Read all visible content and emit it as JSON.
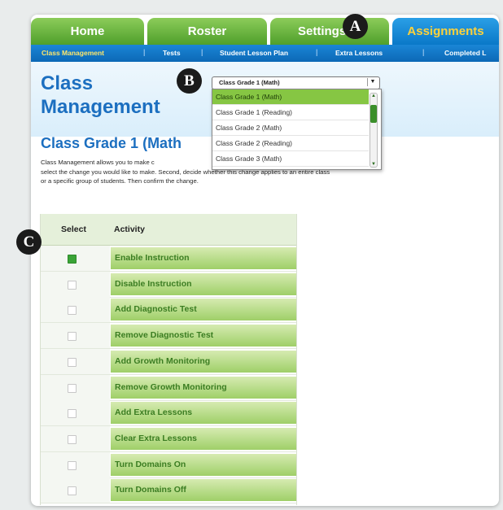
{
  "tabs": [
    {
      "label": "Home"
    },
    {
      "label": "Roster"
    },
    {
      "label": "Settings"
    },
    {
      "label": "Assignments"
    }
  ],
  "subnav": [
    {
      "label": "Class Management"
    },
    {
      "label": "Tests"
    },
    {
      "label": "Student Lesson Plan"
    },
    {
      "label": "Extra Lessons"
    },
    {
      "label": "Completed L"
    }
  ],
  "page_title_line1": "Class",
  "page_title_line2": "Management",
  "class_select": {
    "value": "Class Grade 1 (Math)",
    "arrow": "▼",
    "options": [
      "Class Grade 1 (Math)",
      "Class Grade 1 (Reading)",
      "Class Grade 2 (Math)",
      "Class Grade 2 (Reading)",
      "Class Grade 3 (Math)"
    ]
  },
  "content_title": "Class Grade 1 (Math",
  "description_lines": [
    "Class Management allows you to make c                                                  oup of students. First,",
    "select the change you would like to make. Second, decide whether this change applies to an entire class",
    "or a specific group of students. Then confirm the change."
  ],
  "table": {
    "headers": {
      "select": "Select",
      "activity": "Activity"
    },
    "rows": [
      {
        "activity": "Enable Instruction",
        "checked": true
      },
      {
        "activity": "Disable Instruction",
        "checked": false
      },
      {
        "activity": "Add Diagnostic Test",
        "checked": false
      },
      {
        "activity": "Remove Diagnostic Test",
        "checked": false
      },
      {
        "activity": "Add Growth Monitoring",
        "checked": false
      },
      {
        "activity": "Remove Growth Monitoring",
        "checked": false
      },
      {
        "activity": "Add Extra Lessons",
        "checked": false
      },
      {
        "activity": "Clear Extra Lessons",
        "checked": false
      },
      {
        "activity": "Turn Domains On",
        "checked": false
      },
      {
        "activity": "Turn Domains Off",
        "checked": false
      }
    ]
  },
  "callouts": {
    "a": "A",
    "b": "B",
    "c": "C"
  },
  "colors": {
    "tab_green": "#5aa834",
    "tab_active_blue": "#0f82d2",
    "title_blue": "#1c6fc0",
    "checkbox_green": "#3aa437"
  }
}
